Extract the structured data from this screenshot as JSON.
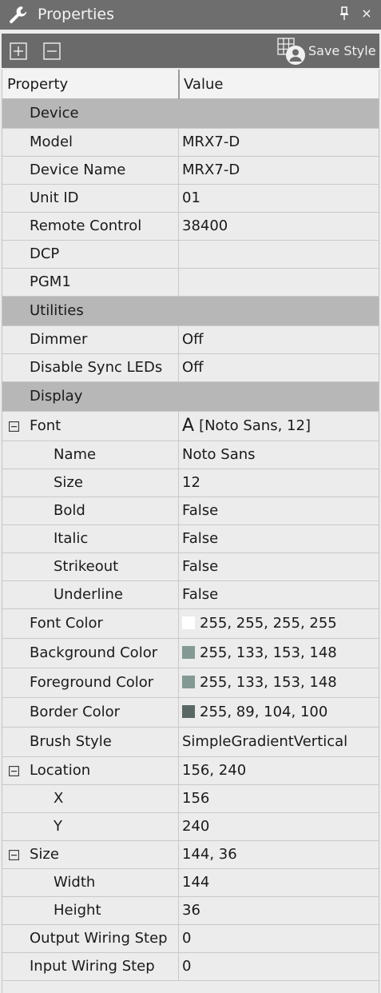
{
  "window": {
    "title": "Properties",
    "close_glyph": "×"
  },
  "toolbar": {
    "save_style_label": "Save Style"
  },
  "grid": {
    "header": {
      "property": "Property",
      "value": "Value"
    },
    "rows": [
      {
        "kind": "category",
        "name": "Device"
      },
      {
        "kind": "prop",
        "name": "Model",
        "value": "MRX7-D"
      },
      {
        "kind": "prop",
        "name": "Device Name",
        "value": "MRX7-D"
      },
      {
        "kind": "prop",
        "name": "Unit ID",
        "value": "01"
      },
      {
        "kind": "prop",
        "name": "Remote Control",
        "value": "38400"
      },
      {
        "kind": "prop",
        "name": "DCP",
        "value": ""
      },
      {
        "kind": "prop",
        "name": "PGM1",
        "value": ""
      },
      {
        "kind": "category",
        "name": "Utilities"
      },
      {
        "kind": "prop",
        "name": "Dimmer",
        "value": "Off"
      },
      {
        "kind": "prop",
        "name": "Disable Sync LEDs",
        "value": "Off"
      },
      {
        "kind": "category",
        "name": "Display"
      },
      {
        "kind": "group",
        "name": "Font",
        "value": "[Noto Sans, 12]",
        "value_icon": "A"
      },
      {
        "kind": "sub",
        "name": "Name",
        "value": "Noto Sans"
      },
      {
        "kind": "sub",
        "name": "Size",
        "value": "12"
      },
      {
        "kind": "sub",
        "name": "Bold",
        "value": "False"
      },
      {
        "kind": "sub",
        "name": "Italic",
        "value": "False"
      },
      {
        "kind": "sub",
        "name": "Strikeout",
        "value": "False"
      },
      {
        "kind": "sub",
        "name": "Underline",
        "value": "False"
      },
      {
        "kind": "color",
        "name": "Font Color",
        "value": "255, 255, 255, 255",
        "swatch": "#ffffff"
      },
      {
        "kind": "color",
        "name": "Background Color",
        "value": "255, 133, 153, 148",
        "swatch": "#859994"
      },
      {
        "kind": "color",
        "name": "Foreground Color",
        "value": "255, 133, 153, 148",
        "swatch": "#859994"
      },
      {
        "kind": "color",
        "name": "Border Color",
        "value": "255, 89, 104, 100",
        "swatch": "#596864"
      },
      {
        "kind": "prop",
        "name": "Brush Style",
        "value": "SimpleGradientVertical"
      },
      {
        "kind": "group",
        "name": "Location",
        "value": "156, 240"
      },
      {
        "kind": "sub",
        "name": "X",
        "value": "156"
      },
      {
        "kind": "sub",
        "name": "Y",
        "value": "240"
      },
      {
        "kind": "group",
        "name": "Size",
        "value": "144, 36"
      },
      {
        "kind": "sub",
        "name": "Width",
        "value": "144"
      },
      {
        "kind": "sub",
        "name": "Height",
        "value": "36"
      },
      {
        "kind": "prop",
        "name": "Output Wiring Step",
        "value": "0"
      },
      {
        "kind": "prop",
        "name": "Input Wiring Step",
        "value": "0"
      }
    ]
  },
  "colors": {
    "titlebar_bg": "#6e6e6e",
    "toolbar_bg": "#6a6a6a",
    "category_bg": "#b7b7b7",
    "grid_bg": "#ececec"
  },
  "icons": {
    "title": "wrench-icon",
    "pin": "pin-icon",
    "close": "close-icon",
    "expand_all": "plus-square-icon",
    "collapse_all": "minus-square-icon",
    "save_style": "grid-user-icon",
    "group_toggle": "minus-square-icon"
  }
}
